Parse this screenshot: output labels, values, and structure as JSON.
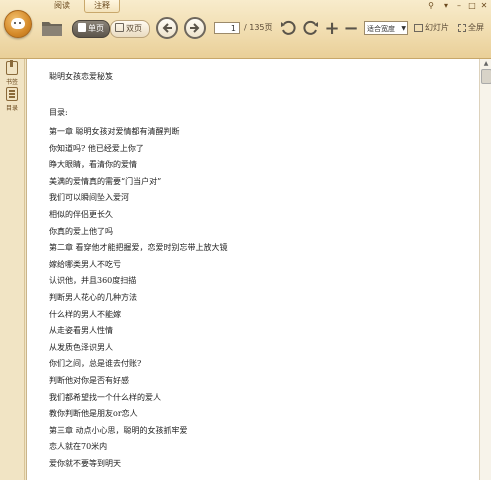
{
  "tabs": [
    {
      "label": "阅读"
    },
    {
      "label": "注释"
    }
  ],
  "toolbar": {
    "single_page_label": "单页",
    "double_page_label": "双页",
    "current_page": "1",
    "total_pages": "/ 135页",
    "zoom_value": "适合宽度",
    "slideshow_label": "幻灯片",
    "fullscreen_label": "全屏"
  },
  "sidebar": {
    "items": [
      {
        "label": "书签",
        "icon": "bookmark-icon"
      },
      {
        "label": "目录",
        "icon": "toc-icon"
      }
    ]
  },
  "document": {
    "title": "聪明女孩恋爱秘笈",
    "toc_label": "目录:",
    "toc": [
      "第一章 聪明女孩对爱情都有清醒判断",
      "你知道吗? 他已经爱上你了",
      "睁大眼睛，看清你的爱情",
      "美满的爱情真的需要“门当户对”",
      "我们可以瞬间坠入爱河",
      "相似的伴侣更长久",
      "你真的爱上他了吗",
      "第二章 看穿他才能把握爱，恋爱时别忘带上放大镜",
      "嫁给哪类男人不吃亏",
      "认识他，并且360度扫描",
      "判断男人花心的几种方法",
      "什么样的男人不能嫁",
      "从走姿看男人性情",
      "从发质色泽识男人",
      "你们之间，总是谁去付账?",
      "判断他对你是否有好感",
      "我们都希望找一个什么样的爱人",
      "教你判断他是朋友or恋人",
      "第三章 动点小心思，聪明的女孩抓牢爱",
      "恋人就在70米内",
      "爱你就不要等到明天"
    ]
  }
}
